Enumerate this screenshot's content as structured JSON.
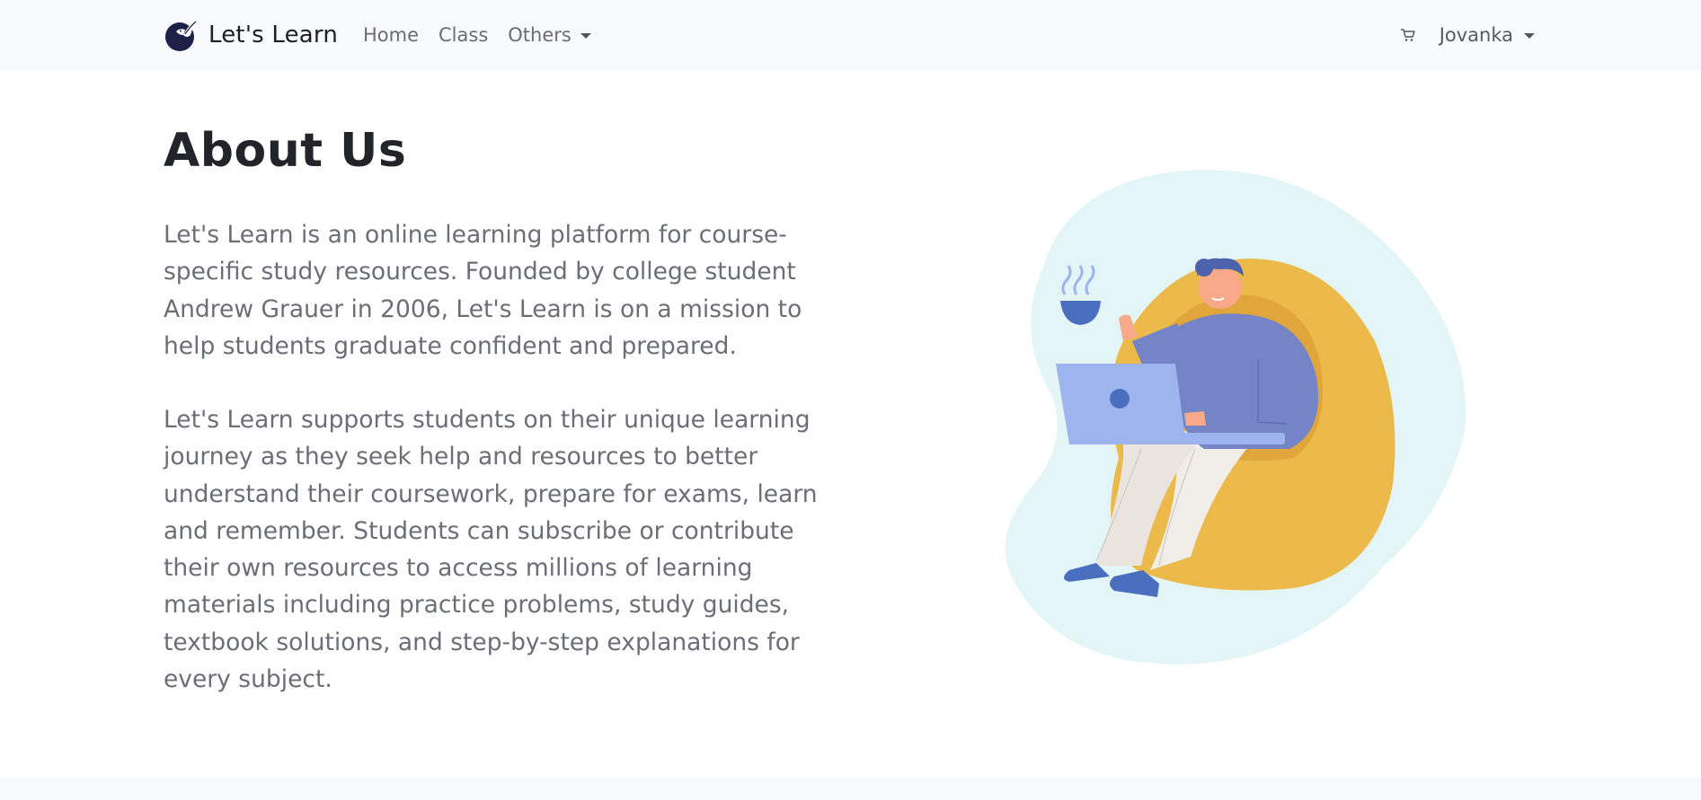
{
  "navbar": {
    "brand": "Let's Learn",
    "links": [
      {
        "label": "Home"
      },
      {
        "label": "Class"
      },
      {
        "label": "Others"
      }
    ],
    "user": "Jovanka",
    "icons": {
      "logo": "bird-logo-icon",
      "cart": "cart-icon",
      "caret": "caret-down-icon"
    }
  },
  "main": {
    "title": "About Us",
    "paragraph1": "Let's Learn is an online learning platform for course-specific study resources. Founded by college student Andrew Grauer in 2006, Let's Learn is on a mission to help students graduate confident and prepared.",
    "paragraph2": "Let's Learn supports students on their unique learning journey as they seek help and resources to better understand their coursework, prepare for exams, learn and remember. Students can subscribe or contribute their own resources to access millions of learning materials including practice problems, study guides, textbook solutions, and step-by-step explanations for every subject."
  },
  "colors": {
    "navbar_bg": "#f8f9fa",
    "text_body": "#6a6f76",
    "blob": "#e3f5f7",
    "chair": "#ecb94b",
    "shirt": "#7484c6",
    "laptop": "#9db4ef",
    "pants": "#f1ede9",
    "shoes": "#4a6fbe"
  }
}
